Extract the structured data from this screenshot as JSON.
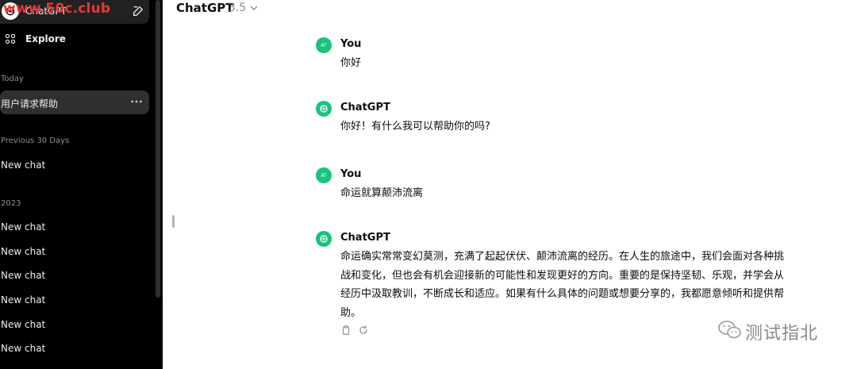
{
  "sidebar": {
    "top_title": "ChatGPT",
    "watermark": "www.50c.club",
    "explore_label": "Explore",
    "sections": [
      {
        "label": "Today"
      },
      {
        "label": "Previous 30 Days"
      },
      {
        "label": "2023"
      }
    ],
    "today_items": [
      "用户请求帮助"
    ],
    "prev30_items": [
      "New chat"
    ],
    "y2023_items": [
      "New chat",
      "New chat",
      "New chat",
      "New chat",
      "New chat",
      "New chat"
    ]
  },
  "header": {
    "model_name": "ChatGPT",
    "model_version": "3.5"
  },
  "messages": [
    {
      "author": "You",
      "avatar_text": "AT",
      "text": "你好"
    },
    {
      "author": "ChatGPT",
      "text": "你好！有什么我可以帮助你的吗?"
    },
    {
      "author": "You",
      "avatar_text": "AT",
      "text": "命运就算颠沛流离"
    },
    {
      "author": "ChatGPT",
      "lines": [
        "命运确实常常变幻莫测，充满了起起伏伏、颠沛流离的经历。在人生的旅途中，我们会面对各种挑",
        "战和变化，但也会有机会迎接新的可能性和发现更好的方向。重要的是保持坚韧、乐观，并学会从",
        "经历中汲取教训，不断成长和适应。如果有什么具体的问题或想要分享的，我都愿意倾听和提供帮",
        "助。"
      ]
    }
  ],
  "watermark_footer": "测试指北",
  "colors": {
    "accent": "#19c37d",
    "sidebar_bg": "#000000",
    "active_item": "#2f2f2f"
  }
}
